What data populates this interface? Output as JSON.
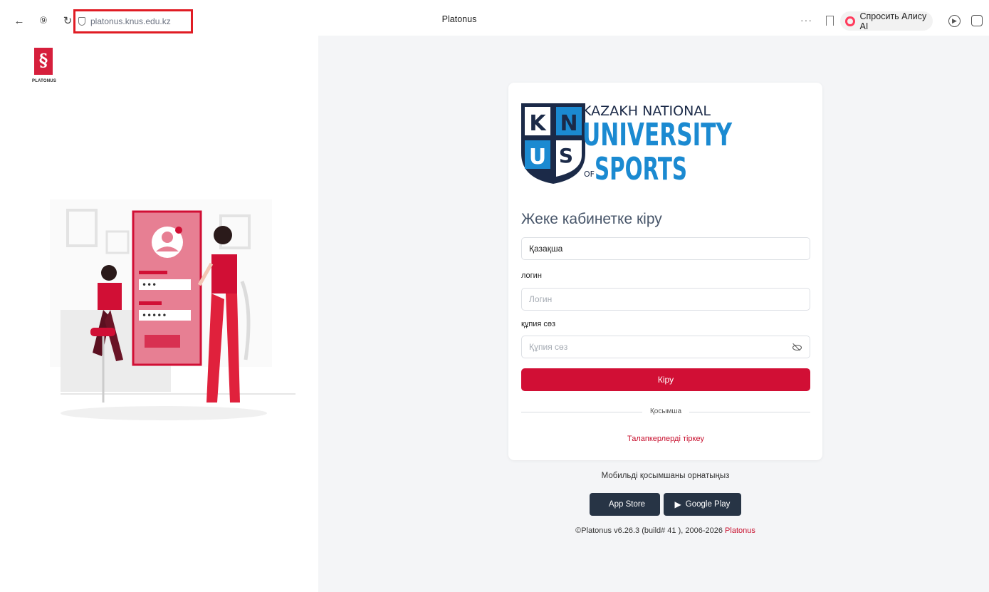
{
  "browser": {
    "address": "platonus.knus.edu.kz",
    "tab_title": "Platonus",
    "alice_label": "Спросить Алису AI",
    "more_label": "···"
  },
  "brand": {
    "name": "PLATONUS",
    "accent": "#d61f3c"
  },
  "logo": {
    "letters": [
      "K",
      "N",
      "U",
      "S"
    ],
    "line1": "KAZAKH NATIONAL",
    "line2": "UNIVERSITY",
    "line3_prefix": "OF",
    "line3": "SPORTS",
    "navy": "#1b2a48",
    "blue": "#1b8ad1"
  },
  "login": {
    "title": "Жеке кабинетке кіру",
    "language_value": "Қазақша",
    "login_label": "логин",
    "login_placeholder": "Логин",
    "password_label": "құпия сөз",
    "password_placeholder": "Құпия сөз",
    "submit_label": "Кіру",
    "divider_label": "Қосымша",
    "register_link": "Талапкерлерді тіркеу"
  },
  "mobile": {
    "prompt": "Мобильді қосымшаны орнатыңыз",
    "app_store": "App Store",
    "google_play": "Google Play"
  },
  "footer": {
    "copyright": "©Platonus v6.26.3 (build# 41 ), 2006-2026 ",
    "link": "Platonus"
  },
  "colors": {
    "primary_red": "#d10f35",
    "dark_button": "#273445",
    "page_bg": "#f4f5f7"
  }
}
